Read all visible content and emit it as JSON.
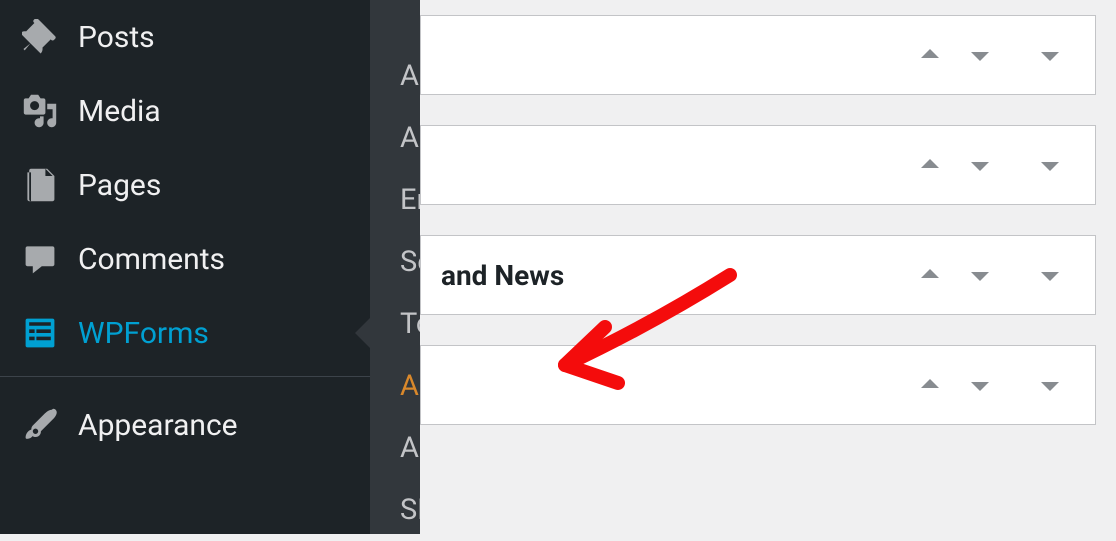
{
  "sidebar": {
    "items": [
      {
        "label": "Posts",
        "icon": "pin",
        "active": false
      },
      {
        "label": "Media",
        "icon": "media",
        "active": false
      },
      {
        "label": "Pages",
        "icon": "pages",
        "active": false
      },
      {
        "label": "Comments",
        "icon": "comment",
        "active": false
      },
      {
        "label": "WPForms",
        "icon": "wpforms",
        "active": true
      },
      {
        "label": "Appearance",
        "icon": "brush",
        "active": false
      }
    ]
  },
  "submenu": {
    "items": [
      {
        "label": "All Forms",
        "highlighted": false
      },
      {
        "label": "Add New",
        "highlighted": false
      },
      {
        "label": "Entries",
        "highlighted": false
      },
      {
        "label": "Settings",
        "highlighted": false
      },
      {
        "label": "Tools",
        "highlighted": false
      },
      {
        "label": "Addons",
        "highlighted": true
      },
      {
        "label": "Analytics",
        "highlighted": false
      },
      {
        "label": "SMTP",
        "highlighted": false
      }
    ]
  },
  "metaboxes": [
    {
      "title": ""
    },
    {
      "title": ""
    },
    {
      "title": "and News"
    },
    {
      "title": ""
    }
  ]
}
